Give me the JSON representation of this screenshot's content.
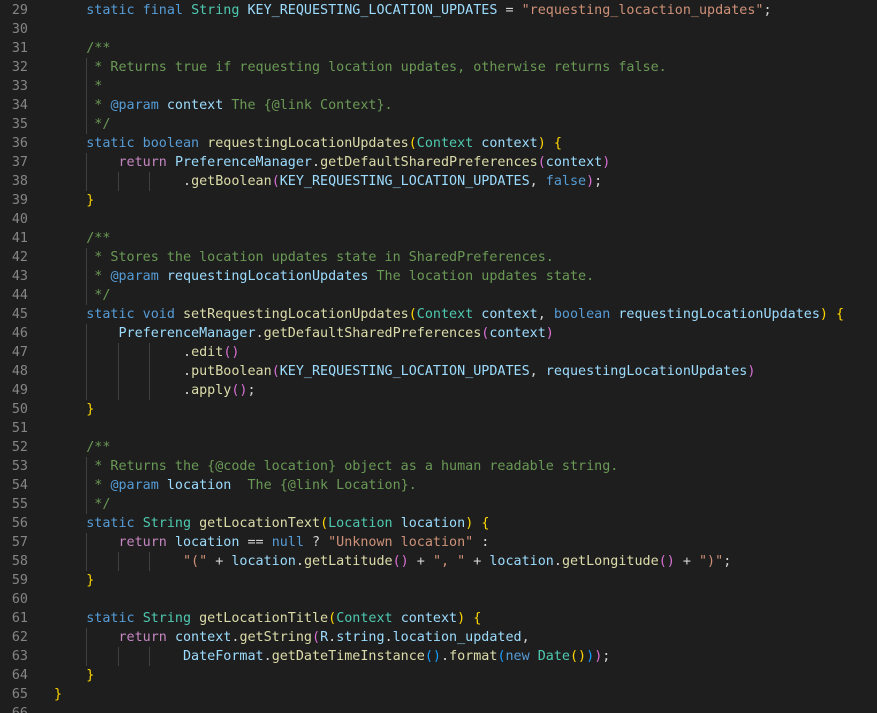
{
  "editor": {
    "lines": [
      {
        "n": "29",
        "t": [
          [
            "    ",
            "p"
          ],
          [
            "static final",
            "kw"
          ],
          [
            " ",
            "p"
          ],
          [
            "String",
            "ty"
          ],
          [
            " ",
            "p"
          ],
          [
            "KEY_REQUESTING_LOCATION_UPDATES",
            "var"
          ],
          [
            " = ",
            "p"
          ],
          [
            "\"requesting_locaction_updates\"",
            "str"
          ],
          [
            ";",
            "p"
          ]
        ]
      },
      {
        "n": "30",
        "t": []
      },
      {
        "n": "31",
        "t": [
          [
            "    ",
            "p"
          ],
          [
            "/**",
            "cm"
          ]
        ]
      },
      {
        "n": "32",
        "t": [
          [
            "    ",
            "p"
          ],
          [
            " * Returns true if requesting location updates, otherwise returns false.",
            "cm"
          ]
        ]
      },
      {
        "n": "33",
        "t": [
          [
            "    ",
            "p"
          ],
          [
            " *",
            "cm"
          ]
        ]
      },
      {
        "n": "34",
        "t": [
          [
            "    ",
            "p"
          ],
          [
            " * ",
            "cm"
          ],
          [
            "@param",
            "jd"
          ],
          [
            " ",
            "cm"
          ],
          [
            "context",
            "var"
          ],
          [
            " The {@link Context}.",
            "cm"
          ]
        ]
      },
      {
        "n": "35",
        "t": [
          [
            "    ",
            "p"
          ],
          [
            " */",
            "cm"
          ]
        ]
      },
      {
        "n": "36",
        "t": [
          [
            "    ",
            "p"
          ],
          [
            "static boolean",
            "kw"
          ],
          [
            " ",
            "p"
          ],
          [
            "requestingLocationUpdates",
            "fn"
          ],
          [
            "(",
            "b1"
          ],
          [
            "Context",
            "ty"
          ],
          [
            " ",
            "p"
          ],
          [
            "context",
            "var"
          ],
          [
            ")",
            "b1"
          ],
          [
            " ",
            "p"
          ],
          [
            "{",
            "b1"
          ]
        ]
      },
      {
        "n": "37",
        "t": [
          [
            "        ",
            "p"
          ],
          [
            "return",
            "ctl"
          ],
          [
            " ",
            "p"
          ],
          [
            "PreferenceManager",
            "var"
          ],
          [
            ".",
            "p"
          ],
          [
            "getDefaultSharedPreferences",
            "fn"
          ],
          [
            "(",
            "b2"
          ],
          [
            "context",
            "var"
          ],
          [
            ")",
            "b2"
          ]
        ]
      },
      {
        "n": "38",
        "t": [
          [
            "                ",
            "p"
          ],
          [
            ".",
            "p"
          ],
          [
            "getBoolean",
            "fn"
          ],
          [
            "(",
            "b2"
          ],
          [
            "KEY_REQUESTING_LOCATION_UPDATES",
            "var"
          ],
          [
            ", ",
            "p"
          ],
          [
            "false",
            "kw"
          ],
          [
            ")",
            "b2"
          ],
          [
            ";",
            "p"
          ]
        ]
      },
      {
        "n": "39",
        "t": [
          [
            "    ",
            "p"
          ],
          [
            "}",
            "b1"
          ]
        ]
      },
      {
        "n": "40",
        "t": []
      },
      {
        "n": "41",
        "t": [
          [
            "    ",
            "p"
          ],
          [
            "/**",
            "cm"
          ]
        ]
      },
      {
        "n": "42",
        "t": [
          [
            "    ",
            "p"
          ],
          [
            " * Stores the location updates state in SharedPreferences.",
            "cm"
          ]
        ]
      },
      {
        "n": "43",
        "t": [
          [
            "    ",
            "p"
          ],
          [
            " * ",
            "cm"
          ],
          [
            "@param",
            "jd"
          ],
          [
            " ",
            "cm"
          ],
          [
            "requestingLocationUpdates",
            "var"
          ],
          [
            " The location updates state.",
            "cm"
          ]
        ]
      },
      {
        "n": "44",
        "t": [
          [
            "    ",
            "p"
          ],
          [
            " */",
            "cm"
          ]
        ]
      },
      {
        "n": "45",
        "t": [
          [
            "    ",
            "p"
          ],
          [
            "static void",
            "kw"
          ],
          [
            " ",
            "p"
          ],
          [
            "setRequestingLocationUpdates",
            "fn"
          ],
          [
            "(",
            "b1"
          ],
          [
            "Context",
            "ty"
          ],
          [
            " ",
            "p"
          ],
          [
            "context",
            "var"
          ],
          [
            ", ",
            "p"
          ],
          [
            "boolean",
            "kw"
          ],
          [
            " ",
            "p"
          ],
          [
            "requestingLocationUpdates",
            "var"
          ],
          [
            ")",
            "b1"
          ],
          [
            " ",
            "p"
          ],
          [
            "{",
            "b1"
          ]
        ]
      },
      {
        "n": "46",
        "t": [
          [
            "        ",
            "p"
          ],
          [
            "PreferenceManager",
            "var"
          ],
          [
            ".",
            "p"
          ],
          [
            "getDefaultSharedPreferences",
            "fn"
          ],
          [
            "(",
            "b2"
          ],
          [
            "context",
            "var"
          ],
          [
            ")",
            "b2"
          ]
        ]
      },
      {
        "n": "47",
        "t": [
          [
            "                ",
            "p"
          ],
          [
            ".",
            "p"
          ],
          [
            "edit",
            "fn"
          ],
          [
            "()",
            "b2"
          ]
        ]
      },
      {
        "n": "48",
        "t": [
          [
            "                ",
            "p"
          ],
          [
            ".",
            "p"
          ],
          [
            "putBoolean",
            "fn"
          ],
          [
            "(",
            "b2"
          ],
          [
            "KEY_REQUESTING_LOCATION_UPDATES",
            "var"
          ],
          [
            ", ",
            "p"
          ],
          [
            "requestingLocationUpdates",
            "var"
          ],
          [
            ")",
            "b2"
          ]
        ]
      },
      {
        "n": "49",
        "t": [
          [
            "                ",
            "p"
          ],
          [
            ".",
            "p"
          ],
          [
            "apply",
            "fn"
          ],
          [
            "()",
            "b2"
          ],
          [
            ";",
            "p"
          ]
        ]
      },
      {
        "n": "50",
        "t": [
          [
            "    ",
            "p"
          ],
          [
            "}",
            "b1"
          ]
        ]
      },
      {
        "n": "51",
        "t": []
      },
      {
        "n": "52",
        "t": [
          [
            "    ",
            "p"
          ],
          [
            "/**",
            "cm"
          ]
        ]
      },
      {
        "n": "53",
        "t": [
          [
            "    ",
            "p"
          ],
          [
            " * Returns the {@code location} object as a human readable string.",
            "cm"
          ]
        ]
      },
      {
        "n": "54",
        "t": [
          [
            "    ",
            "p"
          ],
          [
            " * ",
            "cm"
          ],
          [
            "@param",
            "jd"
          ],
          [
            " ",
            "cm"
          ],
          [
            "location",
            "var"
          ],
          [
            "  The {@link Location}.",
            "cm"
          ]
        ]
      },
      {
        "n": "55",
        "t": [
          [
            "    ",
            "p"
          ],
          [
            " */",
            "cm"
          ]
        ]
      },
      {
        "n": "56",
        "t": [
          [
            "    ",
            "p"
          ],
          [
            "static",
            "kw"
          ],
          [
            " ",
            "p"
          ],
          [
            "String",
            "ty"
          ],
          [
            " ",
            "p"
          ],
          [
            "getLocationText",
            "fn"
          ],
          [
            "(",
            "b1"
          ],
          [
            "Location",
            "ty"
          ],
          [
            " ",
            "p"
          ],
          [
            "location",
            "var"
          ],
          [
            ")",
            "b1"
          ],
          [
            " ",
            "p"
          ],
          [
            "{",
            "b1"
          ]
        ]
      },
      {
        "n": "57",
        "t": [
          [
            "        ",
            "p"
          ],
          [
            "return",
            "ctl"
          ],
          [
            " ",
            "p"
          ],
          [
            "location",
            "var"
          ],
          [
            " == ",
            "p"
          ],
          [
            "null",
            "kw"
          ],
          [
            " ? ",
            "p"
          ],
          [
            "\"Unknown location\"",
            "str"
          ],
          [
            " :",
            "p"
          ]
        ]
      },
      {
        "n": "58",
        "t": [
          [
            "                ",
            "p"
          ],
          [
            "\"(\"",
            "str"
          ],
          [
            " + ",
            "p"
          ],
          [
            "location",
            "var"
          ],
          [
            ".",
            "p"
          ],
          [
            "getLatitude",
            "fn"
          ],
          [
            "()",
            "b2"
          ],
          [
            " + ",
            "p"
          ],
          [
            "\", \"",
            "str"
          ],
          [
            " + ",
            "p"
          ],
          [
            "location",
            "var"
          ],
          [
            ".",
            "p"
          ],
          [
            "getLongitude",
            "fn"
          ],
          [
            "()",
            "b2"
          ],
          [
            " + ",
            "p"
          ],
          [
            "\")\"",
            "str"
          ],
          [
            ";",
            "p"
          ]
        ]
      },
      {
        "n": "59",
        "t": [
          [
            "    ",
            "p"
          ],
          [
            "}",
            "b1"
          ]
        ]
      },
      {
        "n": "60",
        "t": []
      },
      {
        "n": "61",
        "t": [
          [
            "    ",
            "p"
          ],
          [
            "static",
            "kw"
          ],
          [
            " ",
            "p"
          ],
          [
            "String",
            "ty"
          ],
          [
            " ",
            "p"
          ],
          [
            "getLocationTitle",
            "fn"
          ],
          [
            "(",
            "b1"
          ],
          [
            "Context",
            "ty"
          ],
          [
            " ",
            "p"
          ],
          [
            "context",
            "var"
          ],
          [
            ")",
            "b1"
          ],
          [
            " ",
            "p"
          ],
          [
            "{",
            "b1"
          ]
        ]
      },
      {
        "n": "62",
        "t": [
          [
            "        ",
            "p"
          ],
          [
            "return",
            "ctl"
          ],
          [
            " ",
            "p"
          ],
          [
            "context",
            "var"
          ],
          [
            ".",
            "p"
          ],
          [
            "getString",
            "fn"
          ],
          [
            "(",
            "b2"
          ],
          [
            "R",
            "var"
          ],
          [
            ".",
            "p"
          ],
          [
            "string",
            "var"
          ],
          [
            ".",
            "p"
          ],
          [
            "location_updated",
            "var"
          ],
          [
            ",",
            "p"
          ]
        ]
      },
      {
        "n": "63",
        "t": [
          [
            "                ",
            "p"
          ],
          [
            "DateFormat",
            "var"
          ],
          [
            ".",
            "p"
          ],
          [
            "getDateTimeInstance",
            "fn"
          ],
          [
            "()",
            "b3"
          ],
          [
            ".",
            "p"
          ],
          [
            "format",
            "fn"
          ],
          [
            "(",
            "b3"
          ],
          [
            "new",
            "kw"
          ],
          [
            " ",
            "p"
          ],
          [
            "Date",
            "ty"
          ],
          [
            "()",
            "b1"
          ],
          [
            ")",
            "b3"
          ],
          [
            ")",
            "b2"
          ],
          [
            ";",
            "p"
          ]
        ]
      },
      {
        "n": "64",
        "t": [
          [
            "    ",
            "p"
          ],
          [
            "}",
            "b1"
          ]
        ]
      },
      {
        "n": "65",
        "t": [
          [
            "}",
            "b1"
          ]
        ]
      },
      {
        "n": "66",
        "t": []
      }
    ]
  }
}
